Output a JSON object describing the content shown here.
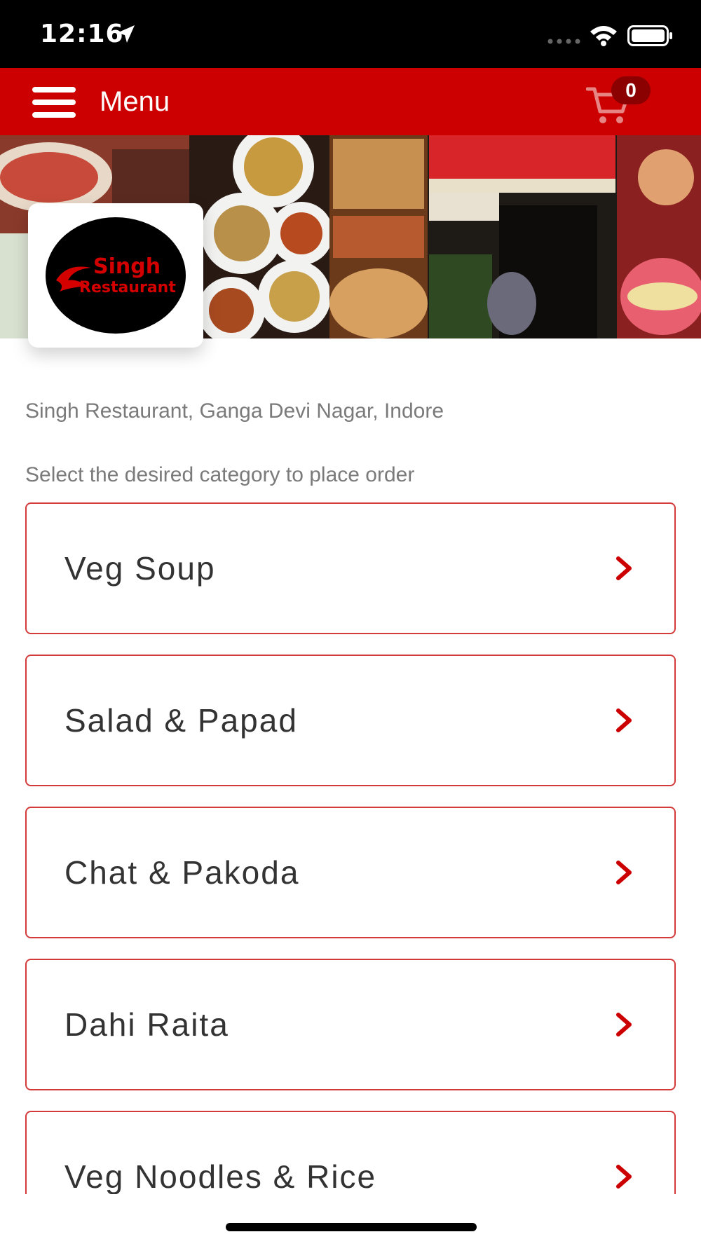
{
  "status_bar": {
    "time": "12:16",
    "icons": [
      "location-arrow-icon",
      "signal-dots-icon",
      "wifi-icon",
      "battery-icon"
    ]
  },
  "app_bar": {
    "title": "Menu",
    "menu_icon": "hamburger-icon",
    "cart_icon": "cart-icon",
    "cart_count": "0",
    "background": "#cc0000"
  },
  "banner": {
    "logo_text_line1": "Singh",
    "logo_text_line2": "Restaurant"
  },
  "restaurant": {
    "address": "Singh Restaurant, Ganga Devi Nagar, Indore"
  },
  "instruction": "Select the desired category to place order",
  "categories": [
    {
      "label": "Veg Soup"
    },
    {
      "label": "Salad & Papad"
    },
    {
      "label": "Chat & Pakoda"
    },
    {
      "label": "Dahi Raita"
    },
    {
      "label": "Veg Noodles & Rice"
    }
  ],
  "colors": {
    "accent": "#cc0000",
    "border": "#d43a3a",
    "chevron": "#cc0000",
    "muted_text": "#7a7a7a"
  }
}
